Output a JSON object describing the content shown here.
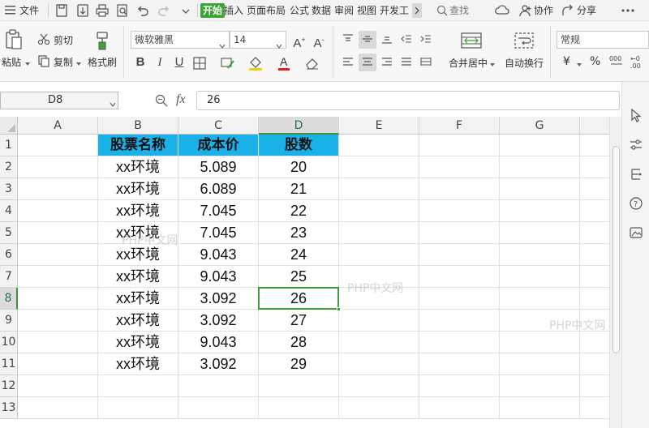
{
  "menubar": {
    "file_label": "文件",
    "tabs": [
      "开始",
      "插入",
      "页面布局",
      "公式",
      "数据",
      "审阅",
      "视图",
      "开发工"
    ],
    "search_label": "查找",
    "collab_label": "协作",
    "share_label": "分享"
  },
  "ribbon": {
    "paste_label": "粘贴",
    "cut_label": "剪切",
    "copy_label": "复制",
    "format_painter_label": "格式刷",
    "font_name": "微软雅黑",
    "font_size": "14",
    "merge_label": "合并居中",
    "wrap_label": "自动换行",
    "number_format": "常规",
    "currency_symbol": "¥",
    "percent_symbol": "%"
  },
  "formula_bar": {
    "name_box": "D8",
    "fx_label": "fx",
    "value": "26"
  },
  "sheet": {
    "columns": [
      "A",
      "B",
      "C",
      "D",
      "E",
      "F",
      "G"
    ],
    "rows": [
      "1",
      "2",
      "3",
      "4",
      "5",
      "6",
      "7",
      "8",
      "9",
      "10",
      "11",
      "12",
      "13"
    ],
    "header": [
      "股票名称",
      "成本价",
      "股数"
    ],
    "data": [
      [
        "xx环境",
        "5.089",
        "20"
      ],
      [
        "xx环境",
        "6.089",
        "21"
      ],
      [
        "xx环境",
        "7.045",
        "22"
      ],
      [
        "xx环境",
        "7.045",
        "23"
      ],
      [
        "xx环境",
        "9.043",
        "24"
      ],
      [
        "xx环境",
        "9.043",
        "25"
      ],
      [
        "xx环境",
        "3.092",
        "26"
      ],
      [
        "xx环境",
        "3.092",
        "27"
      ],
      [
        "xx环境",
        "9.043",
        "28"
      ],
      [
        "xx环境",
        "3.092",
        "29"
      ]
    ],
    "selected_column": "D",
    "selected_row": "8",
    "header_color": "#1ab0e8",
    "selection_color": "#3e9b3e"
  },
  "watermarks": [
    "PHP中文网",
    "PHP中文网",
    "PHP中文网"
  ]
}
